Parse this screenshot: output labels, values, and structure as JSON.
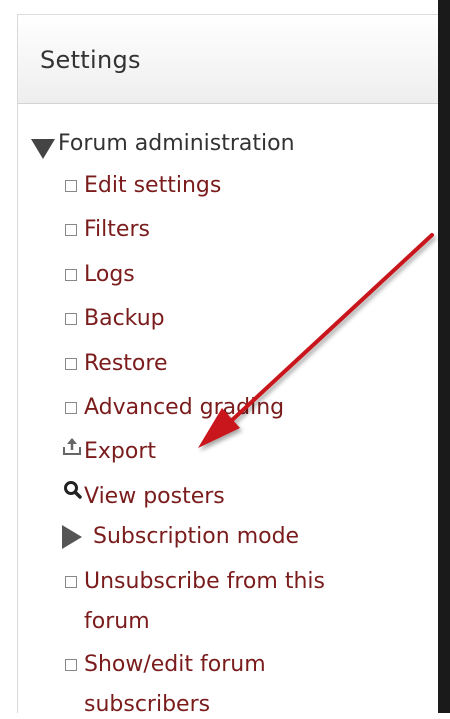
{
  "block": {
    "title": "Settings"
  },
  "tree": {
    "root_label": "Forum administration",
    "items": [
      {
        "label": "Edit settings"
      },
      {
        "label": "Filters"
      },
      {
        "label": "Logs"
      },
      {
        "label": "Backup"
      },
      {
        "label": "Restore"
      },
      {
        "label": "Advanced grading"
      },
      {
        "label": "Export",
        "icon": "export-icon"
      },
      {
        "label": "View posters",
        "icon": "magnifier-icon"
      },
      {
        "label": "Subscription mode",
        "icon": "collapsed-triangle-icon"
      },
      {
        "label_line1": "Unsubscribe from this",
        "label_line2": "forum"
      },
      {
        "label_line1": "Show/edit forum",
        "label_line2": "subscribers"
      }
    ]
  },
  "colors": {
    "link": "#7a1c1c",
    "arrow": "#c8141a"
  }
}
